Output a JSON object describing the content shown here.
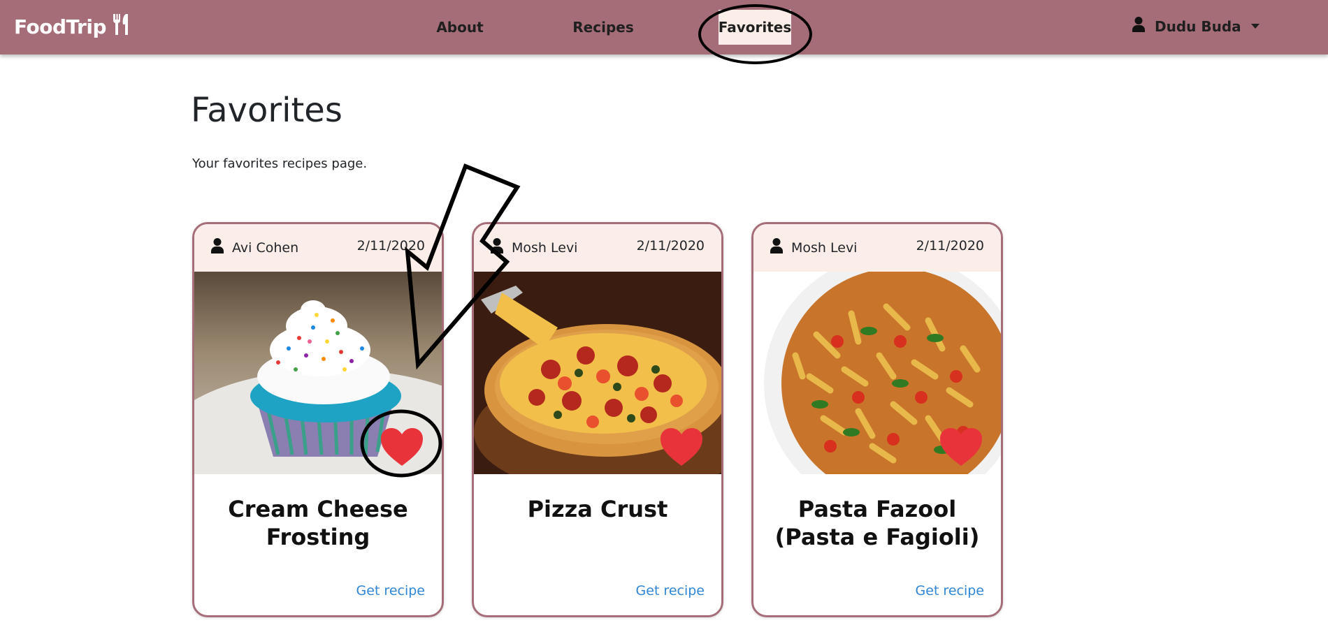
{
  "navbar": {
    "brand": "FoodTrip",
    "links": [
      "About",
      "Recipes",
      "Favorites"
    ],
    "active": "Favorites",
    "user_name": "Dudu Buda"
  },
  "page": {
    "title": "Favorites",
    "subtitle": "Your favorites recipes page."
  },
  "cards": [
    {
      "author": "Avi Cohen",
      "date": "2/11/2020",
      "title": "Cream Cheese Frosting",
      "link": "Get recipe",
      "image": "cupcake-photo",
      "favorited": true
    },
    {
      "author": "Mosh Levi",
      "date": "2/11/2020",
      "title": "Pizza Crust",
      "link": "Get recipe",
      "image": "pizza-photo",
      "favorited": true
    },
    {
      "author": "Mosh Levi",
      "date": "2/11/2020",
      "title": "Pasta Fazool (Pasta e Fagioli)",
      "link": "Get recipe",
      "image": "pasta-photo",
      "favorited": true
    }
  ],
  "colors": {
    "navbar": "#a56d78",
    "card_header": "#fbeee8",
    "heart": "#e8333b",
    "link": "#2f86d6"
  },
  "icons": [
    "utensils-icon",
    "user-icon",
    "person-icon",
    "heart-icon",
    "caret-down-icon"
  ]
}
